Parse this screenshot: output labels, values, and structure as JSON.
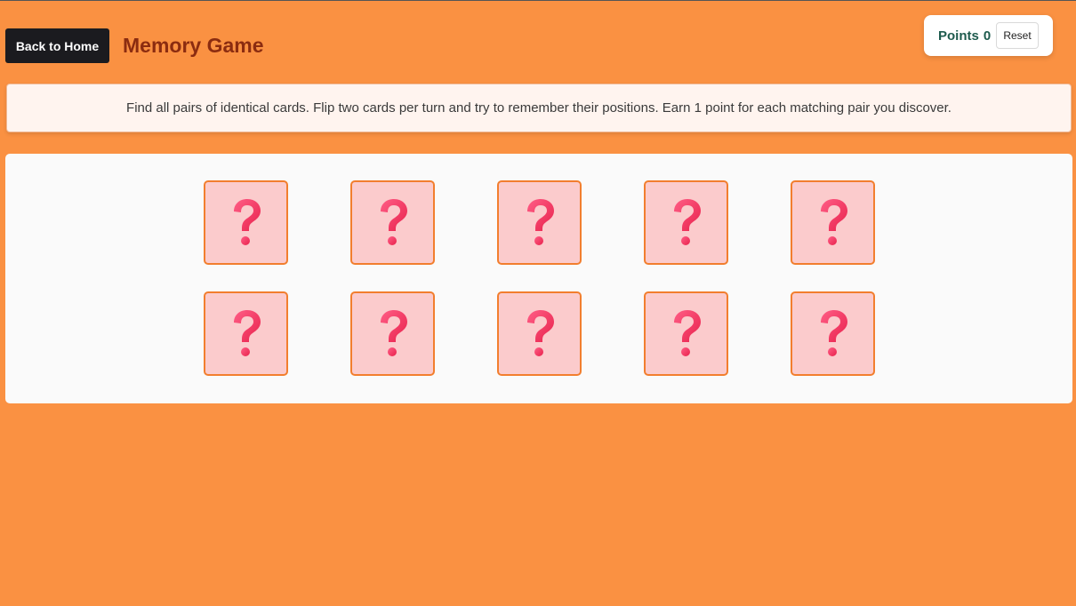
{
  "header": {
    "back_label": "Back to Home",
    "title": "Memory Game"
  },
  "score": {
    "label": "Points",
    "value": "0",
    "reset_label": "Reset"
  },
  "instructions": {
    "text": "Find all pairs of identical cards. Flip two cards per turn and try to remember their positions. Earn 1 point for each matching pair you discover."
  },
  "board": {
    "cards": [
      {
        "face": "hidden",
        "icon": "question-mark-icon"
      },
      {
        "face": "hidden",
        "icon": "question-mark-icon"
      },
      {
        "face": "hidden",
        "icon": "question-mark-icon"
      },
      {
        "face": "hidden",
        "icon": "question-mark-icon"
      },
      {
        "face": "hidden",
        "icon": "question-mark-icon"
      },
      {
        "face": "hidden",
        "icon": "question-mark-icon"
      },
      {
        "face": "hidden",
        "icon": "question-mark-icon"
      },
      {
        "face": "hidden",
        "icon": "question-mark-icon"
      },
      {
        "face": "hidden",
        "icon": "question-mark-icon"
      },
      {
        "face": "hidden",
        "icon": "question-mark-icon"
      }
    ]
  },
  "colors": {
    "background": "#fa9142",
    "card_back": "#fbcbcc",
    "card_border": "#f27e2e",
    "question_mark": "#e8224c",
    "title": "#8b2c10",
    "points": "#1e5b4e"
  }
}
